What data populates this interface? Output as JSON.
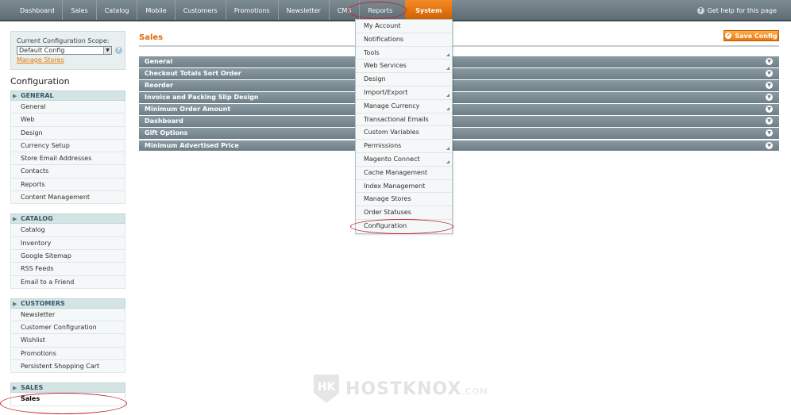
{
  "topnav": {
    "items": [
      "Dashboard",
      "Sales",
      "Catalog",
      "Mobile",
      "Customers",
      "Promotions",
      "Newsletter",
      "CMS",
      "Reports"
    ],
    "active": "System",
    "help": "Get help for this page"
  },
  "scope": {
    "label": "Current Configuration Scope:",
    "value": "Default Config",
    "manage_link": "Manage Stores"
  },
  "sidebar": {
    "title": "Configuration",
    "sections": [
      {
        "name": "GENERAL",
        "items": [
          "General",
          "Web",
          "Design",
          "Currency Setup",
          "Store Email Addresses",
          "Contacts",
          "Reports",
          "Content Management"
        ]
      },
      {
        "name": "CATALOG",
        "items": [
          "Catalog",
          "Inventory",
          "Google Sitemap",
          "RSS Feeds",
          "Email to a Friend"
        ]
      },
      {
        "name": "CUSTOMERS",
        "items": [
          "Newsletter",
          "Customer Configuration",
          "Wishlist",
          "Promotions",
          "Persistent Shopping Cart"
        ]
      },
      {
        "name": "SALES",
        "items": [
          "Sales"
        ]
      }
    ]
  },
  "main": {
    "title": "Sales",
    "save_label": "Save Config",
    "groups": [
      "General",
      "Checkout Totals Sort Order",
      "Reorder",
      "Invoice and Packing Slip Design",
      "Minimum Order Amount",
      "Dashboard",
      "Gift Options",
      "Minimum Advertised Price"
    ]
  },
  "system_menu": {
    "items": [
      "My Account",
      "Notifications",
      "Tools",
      "Web Services",
      "Design",
      "Import/Export",
      "Manage Currency",
      "Transactional Emails",
      "Custom Variables",
      "Permissions",
      "Magento Connect",
      "Cache Management",
      "Index Management",
      "Manage Stores",
      "Order Statuses",
      "Configuration"
    ],
    "with_submenu": [
      "Tools",
      "Web Services",
      "Import/Export",
      "Manage Currency",
      "Permissions",
      "Magento Connect"
    ]
  },
  "watermark": {
    "brand": "HOSTKNOX",
    "suffix": ".COM",
    "mark": "HK"
  },
  "colors": {
    "accent": "#ea7601",
    "nav": "#6f7f88",
    "highlight": "#c0262f"
  }
}
